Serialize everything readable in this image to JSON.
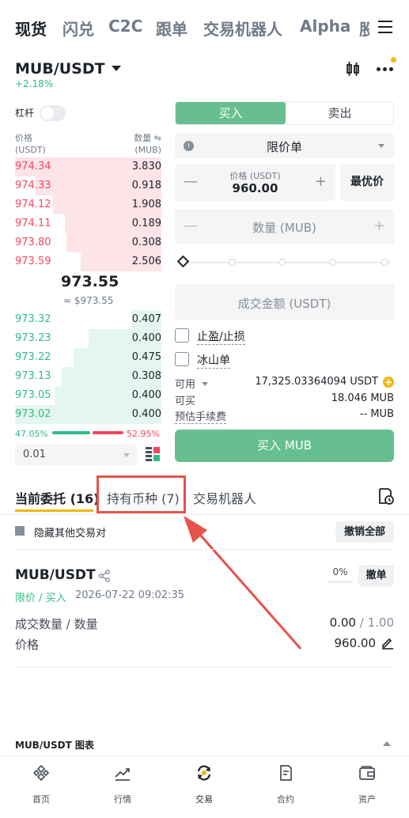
{
  "top_tabs": [
    "现货",
    "闪兑",
    "C2C",
    "跟单",
    "交易机器人",
    "Alpha",
    "股"
  ],
  "pair": {
    "name": "MUB/USDT",
    "change": "+2.18%"
  },
  "leverage_label": "杠杆",
  "orderbook": {
    "price_header": "价格",
    "price_unit": "(USDT)",
    "qty_header": "数量 ⇋",
    "qty_unit": "(MUB)",
    "asks": [
      {
        "price": "974.34",
        "qty": "3.830",
        "depth": 100
      },
      {
        "price": "974.33",
        "qty": "0.918",
        "depth": 86
      },
      {
        "price": "974.12",
        "qty": "1.908",
        "depth": 74
      },
      {
        "price": "974.11",
        "qty": "0.189",
        "depth": 66
      },
      {
        "price": "973.80",
        "qty": "0.308",
        "depth": 65
      },
      {
        "price": "973.59",
        "qty": "2.506",
        "depth": 55
      }
    ],
    "mid_price": "973.55",
    "mid_usd": "≈ $973.55",
    "bids": [
      {
        "price": "973.32",
        "qty": "0.407",
        "depth": 20
      },
      {
        "price": "973.23",
        "qty": "0.400",
        "depth": 50
      },
      {
        "price": "973.22",
        "qty": "0.475",
        "depth": 60
      },
      {
        "price": "973.13",
        "qty": "0.308",
        "depth": 68
      },
      {
        "price": "973.05",
        "qty": "0.400",
        "depth": 73
      },
      {
        "price": "973.02",
        "qty": "0.400",
        "depth": 100
      }
    ],
    "buy_ratio": "47.05%",
    "sell_ratio": "52.95%",
    "precision": "0.01"
  },
  "trade_form": {
    "buy_tab": "买入",
    "sell_tab": "卖出",
    "order_type": "限价单",
    "price_label": "价格 (USDT)",
    "price_value": "960.00",
    "best_price": "最优价",
    "qty_placeholder": "数量 (MUB)",
    "total_placeholder": "成交金额 (USDT)",
    "tp_sl": "止盈/止损",
    "iceberg": "冰山单",
    "available_label": "可用",
    "available_value": "17,325.03364094 USDT",
    "can_buy_label": "可买",
    "can_buy_value": "18.046 MUB",
    "fee_label": "预估手续费",
    "fee_value": "-- MUB",
    "buy_button": "买入 MUB"
  },
  "bottom_tabs": {
    "open_orders": "当前委托 (16)",
    "holdings": "持有币种 (7)",
    "bots": "交易机器人"
  },
  "hide_other_pairs": "隐藏其他交易对",
  "cancel_all": "撤销全部",
  "order": {
    "pair": "MUB/USDT",
    "progress": "0%",
    "cancel": "撤单",
    "meta": "限价 / 买入",
    "time": "2026-07-22 09:02:35",
    "filled_label": "成交数量 / 数量",
    "filled_value": "0.00",
    "total_value": "/ 1.00",
    "price_label": "价格",
    "price_value": "960.00"
  },
  "chart_section": "MUB/USDT 图表",
  "nav": [
    "首页",
    "行情",
    "交易",
    "合约",
    "资产"
  ],
  "colors": {
    "buy": "#2ebd85",
    "sell": "#f6465d",
    "accent": "#f0b90b",
    "highlight": "#e5534b"
  }
}
